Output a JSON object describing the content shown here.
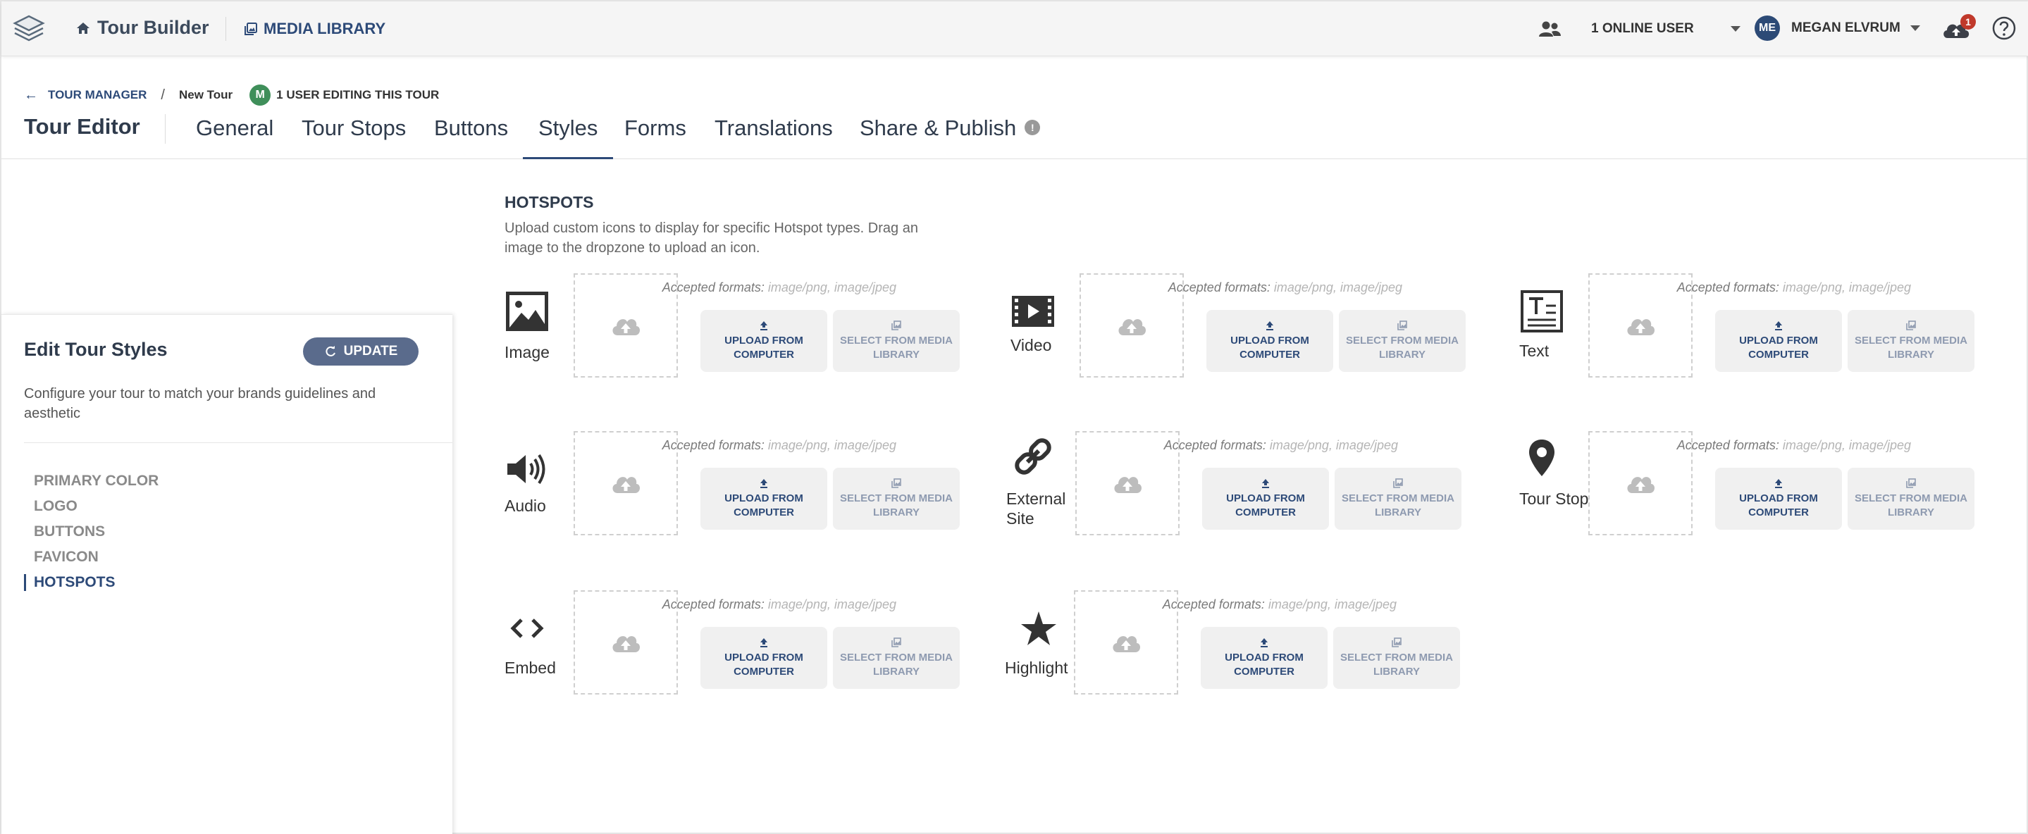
{
  "topbar": {
    "brand": "Tour Builder",
    "media_library": "MEDIA LIBRARY",
    "online_users": "1 ONLINE USER",
    "user_initials": "ME",
    "user_name": "MEGAN ELVRUM",
    "notification_count": "1",
    "icons": [
      "app-logo",
      "home-icon",
      "media-icon",
      "people-icon",
      "cloud-upload-icon",
      "help-icon"
    ]
  },
  "breadcrumb": {
    "back_label": "TOUR MANAGER",
    "separator": "/",
    "current": "New Tour",
    "editor_initial": "M",
    "editing_text": "1 USER EDITING THIS TOUR"
  },
  "page_title": "Tour Editor",
  "tabs": [
    "General",
    "Tour Stops",
    "Buttons",
    "Styles",
    "Forms",
    "Translations",
    "Share & Publish"
  ],
  "active_tab": "Styles",
  "info_badge": "!",
  "panel": {
    "title": "Edit Tour Styles",
    "update_label": "UPDATE",
    "description": "Configure your tour to match your brands guidelines and aesthetic",
    "nav": [
      "PRIMARY COLOR",
      "LOGO",
      "BUTTONS",
      "FAVICON",
      "HOTSPOTS"
    ],
    "active_nav": "HOTSPOTS"
  },
  "hotspots": {
    "title": "HOTSPOTS",
    "description": "Upload custom icons to display for specific Hotspot types. Drag an image to the dropzone to upload an icon.",
    "accepted_label": "Accepted formats:",
    "accepted_formats": "image/png, image/jpeg",
    "upload_label": "UPLOAD FROM COMPUTER",
    "select_label": "SELECT FROM MEDIA LIBRARY",
    "items": [
      {
        "label": "Image",
        "icon": "image-icon"
      },
      {
        "label": "Video",
        "icon": "video-icon"
      },
      {
        "label": "Text",
        "icon": "text-icon"
      },
      {
        "label": "Audio",
        "icon": "audio-icon"
      },
      {
        "label": "External Site",
        "icon": "link-icon"
      },
      {
        "label": "Tour Stop",
        "icon": "map-pin-icon"
      },
      {
        "label": "Embed",
        "icon": "code-icon"
      },
      {
        "label": "Highlight",
        "icon": "star-icon"
      }
    ]
  },
  "colors": {
    "accent": "#2d4a78",
    "update_button": "#5a6b8c",
    "badge": "#c0392b",
    "editor_avatar": "#3f8f5a"
  }
}
